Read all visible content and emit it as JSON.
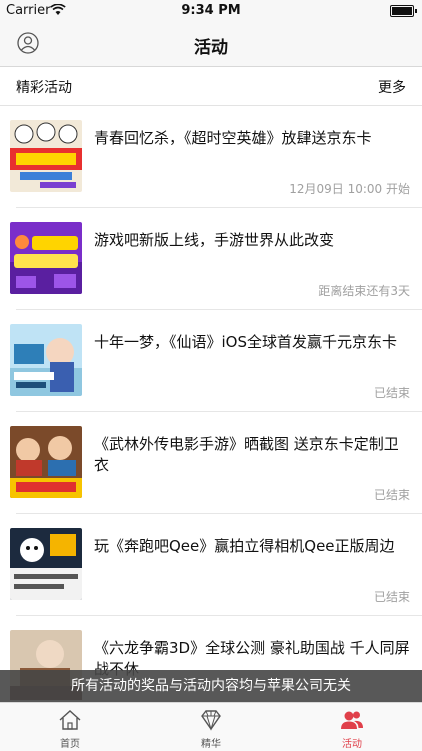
{
  "status_bar": {
    "carrier": "Carrier",
    "time": "9:34 PM"
  },
  "nav": {
    "title": "活动"
  },
  "section": {
    "label": "精彩活动",
    "more": "更多"
  },
  "activities": [
    {
      "title": "青春回忆杀，《超时空英雄》放肆送京东卡",
      "status": "12月09日 10:00 开始"
    },
    {
      "title": "游戏吧新版上线，手游世界从此改变",
      "status": "距离结束还有3天"
    },
    {
      "title": "十年一梦，《仙语》iOS全球首发赢千元京东卡",
      "status": "已结束"
    },
    {
      "title": "《武林外传电影手游》晒截图 送京东卡定制卫衣",
      "status": "已结束"
    },
    {
      "title": "玩《奔跑吧Qee》赢拍立得相机Qee正版周边",
      "status": "已结束"
    },
    {
      "title": "《六龙争霸3D》全球公测 豪礼助国战 千人同屏战不休",
      "status": ""
    }
  ],
  "disclaimer": "所有活动的奖品与活动内容均与苹果公司无关",
  "tabs": [
    {
      "label": "首页",
      "icon": "home-icon",
      "active": false
    },
    {
      "label": "精华",
      "icon": "diamond-icon",
      "active": false
    },
    {
      "label": "活动",
      "icon": "users-icon",
      "active": true
    }
  ],
  "colors": {
    "accent": "#e0404a",
    "status_text": "#a0a0a0"
  }
}
